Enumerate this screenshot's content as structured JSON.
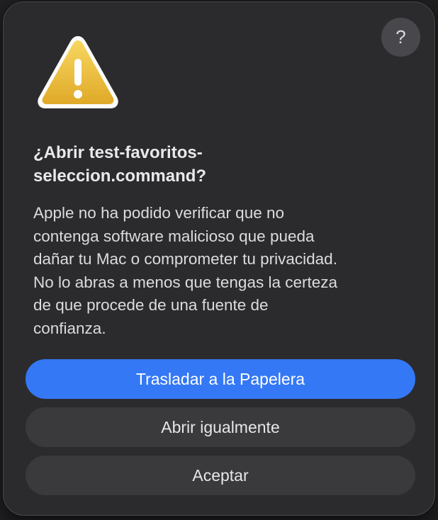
{
  "dialog": {
    "help_label": "?",
    "icon": "warning-triangle-icon",
    "title": "¿Abrir test-favoritos-\nseleccion.command?",
    "message": "Apple no ha podido verificar que no\ncontenga software malicioso que pueda\ndañar tu Mac o comprometer tu privacidad.\nNo lo abras a menos que tengas la certeza\nde que procede de una fuente de\nconfianza.",
    "buttons": {
      "trash": "Trasladar a la Papelera",
      "open_anyway": "Abrir igualmente",
      "accept": "Aceptar"
    }
  },
  "colors": {
    "primary_button": "#3478f6",
    "dialog_background": "#2b2b2e",
    "warning_yellow": "#f2c53d"
  }
}
